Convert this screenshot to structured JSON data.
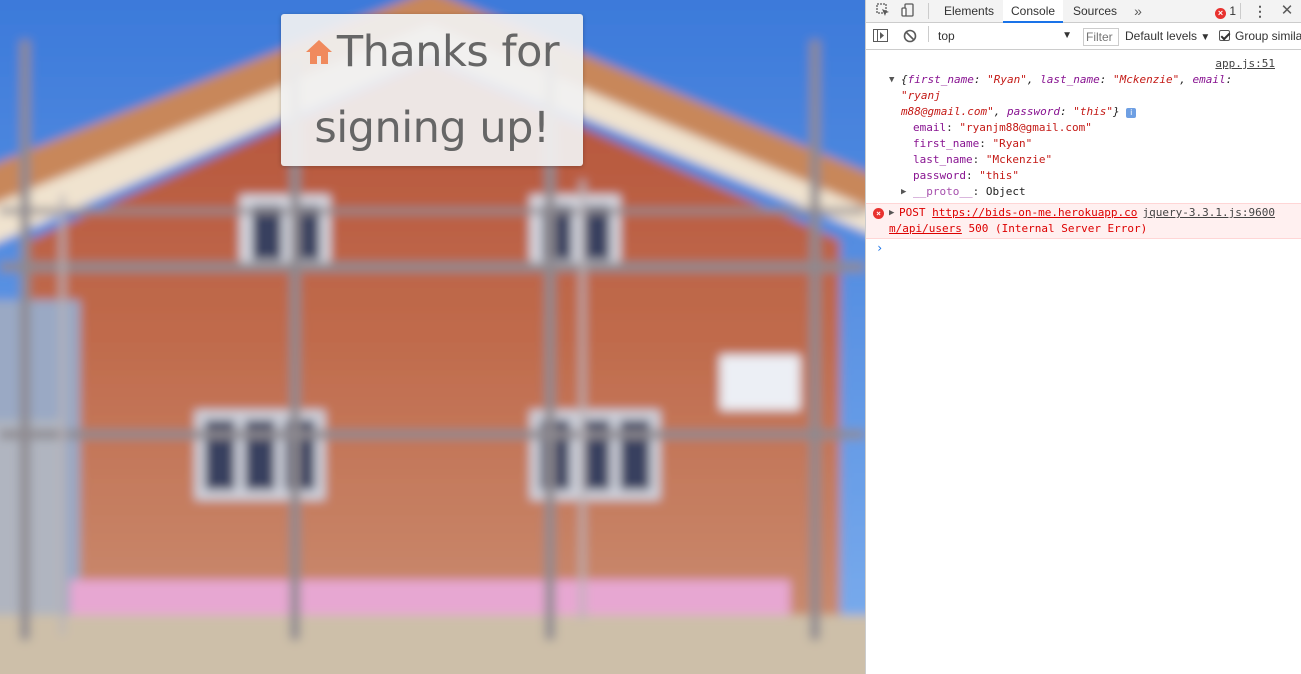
{
  "page": {
    "card": {
      "line1": "Thanks for",
      "line2": "signing up!",
      "icon": "home-icon",
      "icon_color": "#f08a5d"
    }
  },
  "devtools": {
    "tabs": [
      {
        "label": "Elements"
      },
      {
        "label": "Console",
        "active": true
      },
      {
        "label": "Sources"
      }
    ],
    "error_count": "1",
    "toolbar": {
      "context": "top",
      "filter_placeholder": "Filter",
      "levels": "Default levels",
      "group_similar": "Group similar"
    },
    "log": {
      "source": "app.js:51",
      "summary": {
        "first_name_key": "first_name",
        "first_name": "\"Ryan\"",
        "last_name_key": "last_name",
        "last_name": "\"Mckenzie\"",
        "email_key": "email",
        "email_a": "\"ryanj",
        "email_b": "m88@gmail.com\"",
        "password_key": "password",
        "password": "\"this\""
      },
      "props": [
        {
          "key": "email",
          "value": "\"ryanjm88@gmail.com\""
        },
        {
          "key": "first_name",
          "value": "\"Ryan\""
        },
        {
          "key": "last_name",
          "value": "\"Mckenzie\""
        },
        {
          "key": "password",
          "value": "\"this\""
        }
      ],
      "proto_key": "__proto__",
      "proto_value": "Object"
    },
    "error": {
      "method": "POST",
      "url_a": "https://bids-on-me.herokuapp.co",
      "url_b": "m/api/users",
      "status": "500 (Internal Server Error)",
      "source": "jquery-3.3.1.js:9600"
    }
  }
}
